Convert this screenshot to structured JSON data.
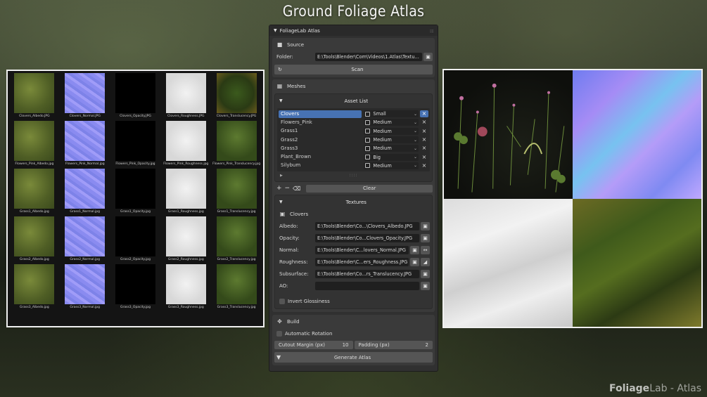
{
  "page_title": "Ground Foliage Atlas",
  "brand": {
    "bold": "Foliage",
    "light": "Lab - Atlas"
  },
  "gallery": {
    "rows": [
      [
        "Clovers_Albedo.JPG",
        "Clovers_Normal.JPG",
        "Clovers_Opacity.JPG",
        "Clovers_Roughness.JPG",
        "Clovers_Translucency.JPG"
      ],
      [
        "Flowers_Pink_Albedo.jpg",
        "Flowers_Pink_Normal.jpg",
        "Flowers_Pink_Opacity.jpg",
        "Flowers_Pink_Roughness.jpg",
        "Flowers_Pink_Translucency.jpg"
      ],
      [
        "Grass1_Albedo.jpg",
        "Grass1_Normal.jpg",
        "Grass1_Opacity.jpg",
        "Grass1_Roughness.jpg",
        "Grass1_Translucency.jpg"
      ],
      [
        "Grass2_Albedo.jpg",
        "Grass2_Normal.jpg",
        "Grass2_Opacity.jpg",
        "Grass2_Roughness.jpg",
        "Grass2_Translucency.jpg"
      ],
      [
        "Grass3_Albedo.jpg",
        "Grass3_Normal.jpg",
        "Grass3_Opacity.jpg",
        "Grass3_Roughness.jpg",
        "Grass3_Translucency.jpg"
      ]
    ]
  },
  "panel": {
    "header": "FoliageLab Atlas",
    "source": {
      "title": "Source",
      "folder_label": "Folder:",
      "folder_value": "E:\\Tools\\Blender\\Com\\Videos\\1.Atlas\\Textu...",
      "scan_label": "Scan"
    },
    "meshes": {
      "title": "Meshes",
      "asset_list_title": "Asset List",
      "assets": [
        {
          "name": "Clovers",
          "size": "Small",
          "selected": true
        },
        {
          "name": "Flowers_Pink",
          "size": "Medium",
          "selected": false
        },
        {
          "name": "Grass1",
          "size": "Medium",
          "selected": false
        },
        {
          "name": "Grass2",
          "size": "Medium",
          "selected": false
        },
        {
          "name": "Grass3",
          "size": "Medium",
          "selected": false
        },
        {
          "name": "Plant_Brown",
          "size": "Big",
          "selected": false
        },
        {
          "name": "Silybum",
          "size": "Medium",
          "selected": false
        }
      ],
      "clear_label": "Clear",
      "textures_title": "Textures",
      "active_asset": "Clovers",
      "textures": [
        {
          "label": "Albedo:",
          "value": "E:\\Tools\\Blender\\Co...\\Clovers_Albedo.JPG"
        },
        {
          "label": "Opacity:",
          "value": "E:\\Tools\\Blender\\Co...Clovers_Opacity.JPG"
        },
        {
          "label": "Normal:",
          "value": "E:\\Tools\\Blender\\C...lovers_Normal.JPG"
        },
        {
          "label": "Roughness:",
          "value": "E:\\Tools\\Blender\\C...ers_Roughness.JPG"
        },
        {
          "label": "Subsurface:",
          "value": "E:\\Tools\\Blender\\Co...rs_Translucency.JPG"
        },
        {
          "label": "AO:",
          "value": ""
        }
      ],
      "invert_glossiness_label": "Invert Glossiness"
    },
    "build": {
      "title": "Build",
      "auto_rotation_label": "Automatic Rotation",
      "cutout_margin_label": "Cutout Margin (px)",
      "cutout_margin_value": "10",
      "padding_label": "Padding (px)",
      "padding_value": "2",
      "generate_label": "Generate Atlas"
    }
  }
}
